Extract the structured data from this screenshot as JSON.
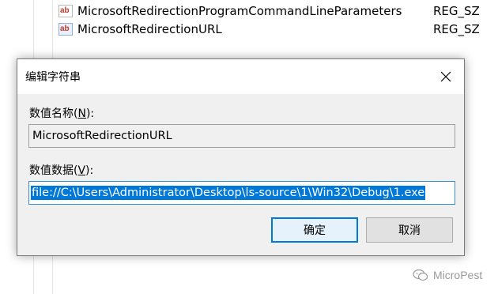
{
  "registry": {
    "rows": [
      {
        "name": "MicrosoftRedirectionProgramCommandLineParameters",
        "type": "REG_SZ",
        "icon": "string-value-icon"
      },
      {
        "name": "MicrosoftRedirectionURL",
        "type": "REG_SZ",
        "icon": "string-value-icon"
      }
    ],
    "icon_glyph": "ab"
  },
  "dialog": {
    "title": "编辑字符串",
    "name_label_prefix": "数值名称(",
    "name_label_key": "N",
    "name_label_suffix": "):",
    "name_value": "MicrosoftRedirectionURL",
    "data_label_prefix": "数值数据(",
    "data_label_key": "V",
    "data_label_suffix": "):",
    "data_value": "file://C:\\Users\\Administrator\\Desktop\\ls-source\\1\\Win32\\Debug\\1.exe",
    "ok_label": "确定",
    "cancel_label": "取消"
  },
  "watermark": {
    "text": "MicroPest"
  },
  "colors": {
    "selection": "#0078d7",
    "dialog_bg": "#f0f0f0",
    "default_button_border": "#0078d7"
  }
}
